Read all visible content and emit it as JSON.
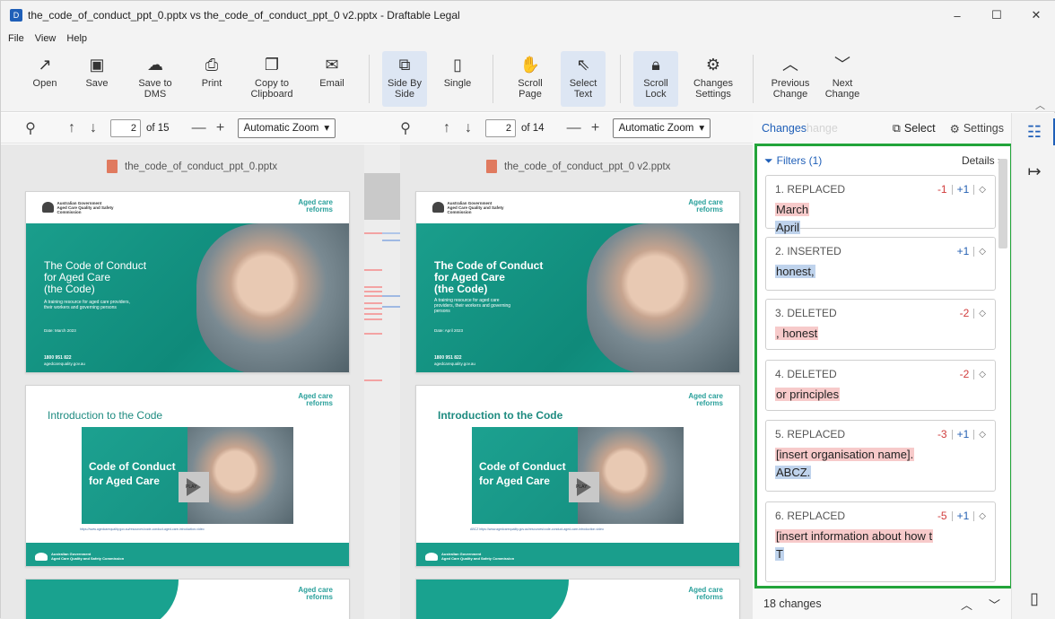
{
  "window": {
    "title": "the_code_of_conduct_ppt_0.pptx vs the_code_of_conduct_ppt_0 v2.pptx - Draftable Legal",
    "minimize": "–",
    "maximize": "☐",
    "close": "✕"
  },
  "menu": [
    "File",
    "View",
    "Help"
  ],
  "ribbon": {
    "open": "Open",
    "save": "Save",
    "save_dms_1": "Save to",
    "save_dms_2": "DMS",
    "print": "Print",
    "copy_1": "Copy to",
    "copy_2": "Clipboard",
    "email": "Email",
    "side_1": "Side By",
    "side_2": "Side",
    "single": "Single",
    "scroll_1": "Scroll",
    "scroll_2": "Page",
    "select_1": "Select",
    "select_2": "Text",
    "lock_1": "Scroll",
    "lock_2": "Lock",
    "changes_1": "Changes",
    "changes_2": "Settings",
    "prev_1": "Previous",
    "prev_2": "Change",
    "next_1": "Next",
    "next_2": "Change"
  },
  "left_toolbar": {
    "page": "2",
    "of": "of 15",
    "zoom": "Automatic Zoom"
  },
  "right_toolbar": {
    "page": "2",
    "of": "of 14",
    "zoom": "Automatic Zoom"
  },
  "left_doc": {
    "filename": "the_code_of_conduct_ppt_0.pptx",
    "gov_1": "Australian Government",
    "gov_2": "Aged Care Quality and Safety Commission",
    "brand_1": "Aged care",
    "brand_2": "reforms",
    "title_1": "The Code of Conduct",
    "title_2": "for Aged Care",
    "title_3": "(the Code)",
    "sub_1": "A training resource for aged care providers,",
    "sub_2": "their workers and governing persons",
    "date": "Date: March 2023",
    "phone": "1800 951 822",
    "web": "agedcarequality.gov.au",
    "intro": "Introduction to the Code",
    "video_1": "Code of Conduct",
    "video_2": "for Aged Care",
    "play": "PLAY",
    "url": "https://www.agedcarequality.gov.au/resources/code-conduct-aged-care-introduction-video"
  },
  "right_doc": {
    "filename": "the_code_of_conduct_ppt_0 v2.pptx",
    "title_1": "The Code of Conduct",
    "title_2": "for Aged Care",
    "title_3": "(the Code)",
    "sub_1": "A training resource for aged care",
    "sub_2": "providers, their workers and governing",
    "sub_3": "persons",
    "date": "Date: April 2023",
    "intro": "Introduction to the Code",
    "url": "ABCZ https://www.agedcarequality.gov.au/resources/code-conduct-aged-care-introduction-video"
  },
  "changes": {
    "title": "Changes",
    "title_ghost": "hange",
    "select": "Select",
    "settings": "Settings",
    "filters": "Filters (1)",
    "details": "Details",
    "count": "18 changes",
    "items": [
      {
        "label": "1. REPLACED",
        "minus": "-1",
        "plus": "+1",
        "del": "March",
        "ins": "April"
      },
      {
        "label": "2. INSERTED",
        "plus": "+1",
        "ins": "honest,"
      },
      {
        "label": "3. DELETED",
        "minus": "-2",
        "del": ", honest"
      },
      {
        "label": "4. DELETED",
        "minus": "-2",
        "del": "or principles"
      },
      {
        "label": "5. REPLACED",
        "minus": "-3",
        "plus": "+1",
        "del": "[insert organisation name].",
        "ins": "ABCZ."
      },
      {
        "label": "6. REPLACED",
        "minus": "-5",
        "plus": "+1",
        "del": "[insert information about how t",
        "ins": "T"
      }
    ]
  },
  "colors": {
    "accent": "#1f5fb8",
    "highlight_border": "#22a43a",
    "deleted": "#f7caca",
    "inserted": "#bfd3ec",
    "teal": "#1a9e8c"
  }
}
